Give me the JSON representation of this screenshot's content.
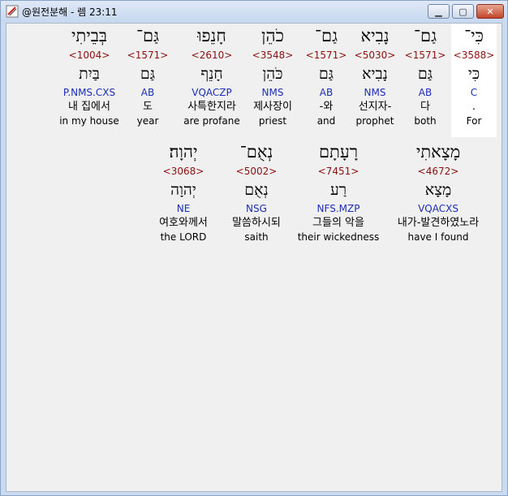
{
  "window": {
    "title": "@원전분해 - 렘 23:11"
  },
  "rows": [
    {
      "words": [
        {
          "hebrew": "כִּי־",
          "strong": "<3588>",
          "lemma": "כִּי",
          "morph": "C",
          "korean": ".",
          "english": "For",
          "highlight": true
        },
        {
          "hebrew": "גַם־",
          "strong": "<1571>",
          "lemma": "גַּם",
          "morph": "AB",
          "korean": "다",
          "english": "both",
          "highlight": false
        },
        {
          "hebrew": "נָבִיא",
          "strong": "<5030>",
          "lemma": "נָבִיא",
          "morph": "NMS",
          "korean": "선지자-",
          "english": "prophet",
          "highlight": false
        },
        {
          "hebrew": "גַם־",
          "strong": "<1571>",
          "lemma": "גַּם",
          "morph": "AB",
          "korean": "-와",
          "english": "and",
          "highlight": false
        },
        {
          "hebrew": "כֹהֵן",
          "strong": "<3548>",
          "lemma": "כֹּהֵן",
          "morph": "NMS",
          "korean": "제사장이",
          "english": "priest",
          "highlight": false
        },
        {
          "hebrew": "חָנֵפוּ",
          "strong": "<2610>",
          "lemma": "חָנֵף",
          "morph": "VQACZP",
          "korean": "사특한지라",
          "english": "are profane",
          "highlight": false
        },
        {
          "hebrew": "גַּם־",
          "strong": "<1571>",
          "lemma": "גַּם",
          "morph": "AB",
          "korean": "도",
          "english": "year",
          "highlight": false
        },
        {
          "hebrew": "בְּבֵיתִי",
          "strong": "<1004>",
          "lemma": "בַּיִת",
          "morph": "P.NMS.CXS",
          "korean": "내 집에서",
          "english": "in my house",
          "highlight": false
        }
      ]
    },
    {
      "words": [
        {
          "hebrew": "מָצָאתִי",
          "strong": "<4672>",
          "lemma": "מָצָא",
          "morph": "VQACXS",
          "korean": "내가-발견하였노라",
          "english": "have I found",
          "highlight": false
        },
        {
          "hebrew": "רָעָתָם",
          "strong": "<7451>",
          "lemma": "רַע",
          "morph": "NFS.MZP",
          "korean": "그들의 악을",
          "english": "their wickedness",
          "highlight": false
        },
        {
          "hebrew": "נְאֻם־",
          "strong": "<5002>",
          "lemma": "נְאֻם",
          "morph": "NSG",
          "korean": "말씀하시되",
          "english": "saith",
          "highlight": false
        },
        {
          "hebrew": "יְהוָה׃",
          "strong": "<3068>",
          "lemma": "יְהוָה",
          "morph": "NE",
          "korean": "여호와께서",
          "english": "the LORD",
          "highlight": false
        }
      ]
    }
  ],
  "icons": {
    "app": "bible-study-app-icon",
    "minimize": "minimize-icon",
    "maximize": "maximize-icon",
    "close": "close-icon"
  }
}
